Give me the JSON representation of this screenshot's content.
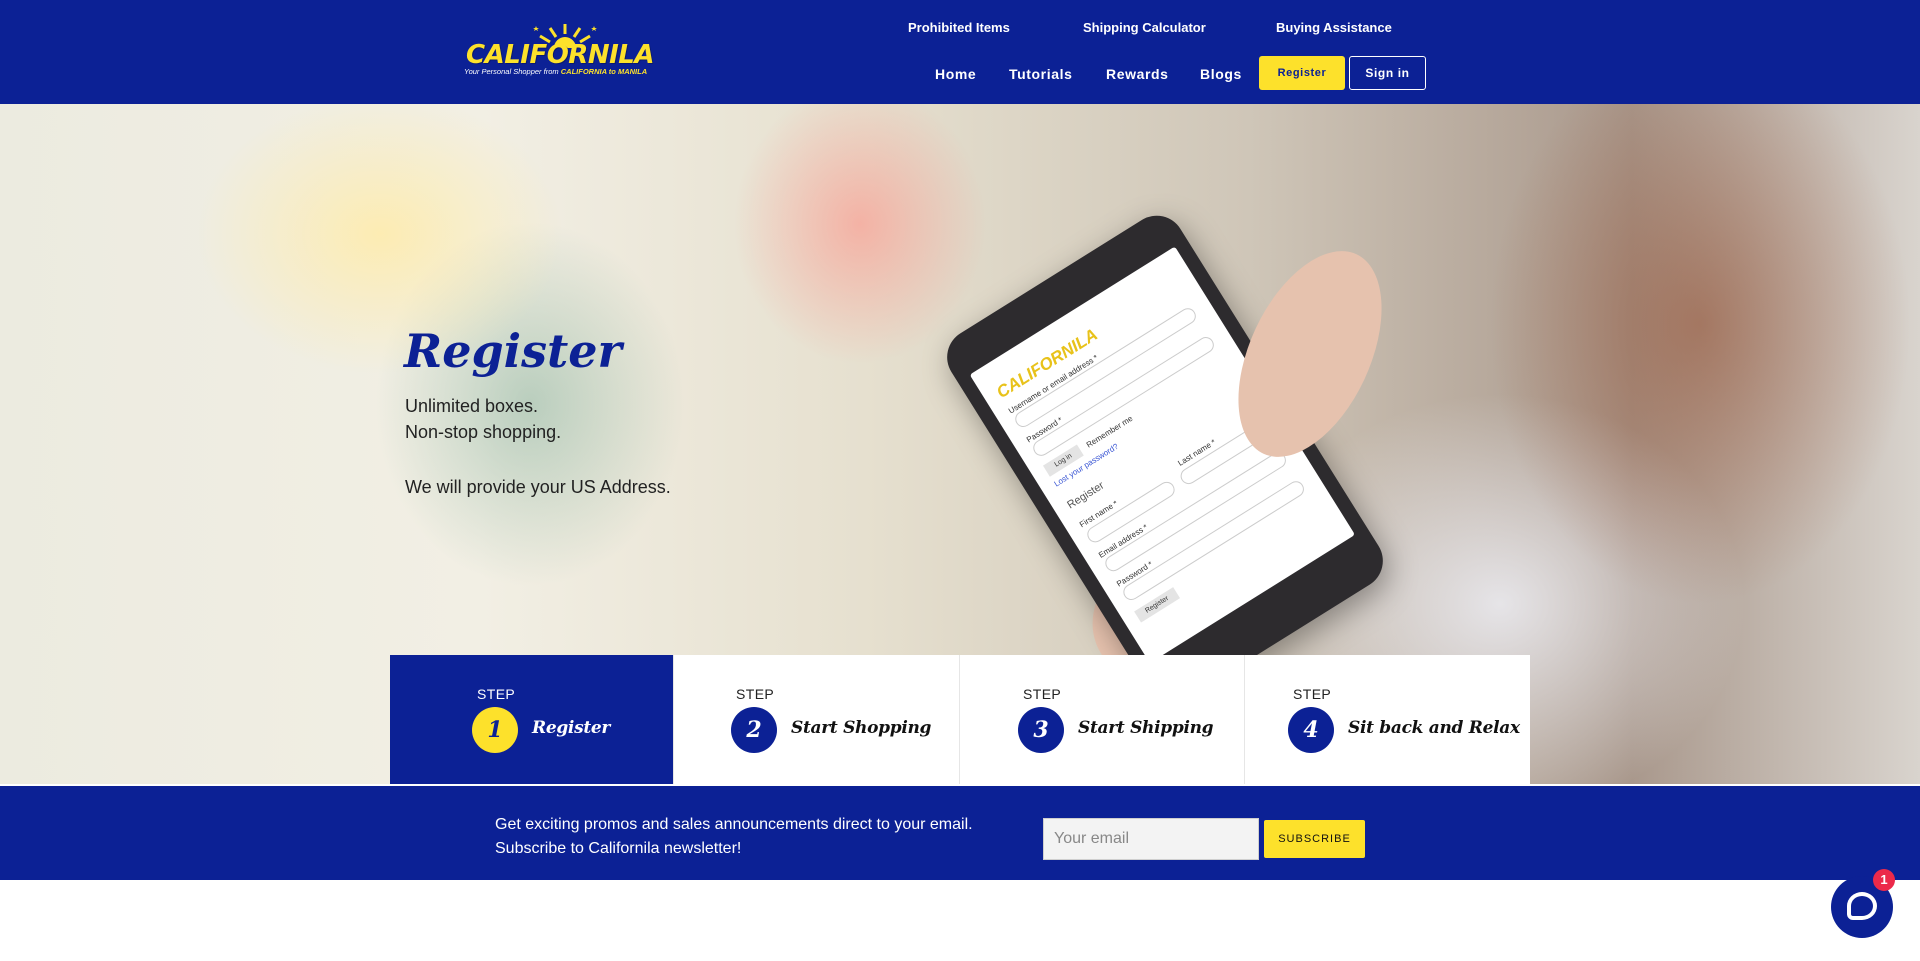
{
  "header": {
    "logo": {
      "wordmark": "CALIFORNILA",
      "tagline_prefix": "Your Personal Shopper from",
      "tagline_highlight": "CALIFORNIA to MANILA"
    },
    "top_links": [
      "Prohibited Items",
      "Shipping Calculator",
      "Buying Assistance"
    ],
    "nav": [
      "Home",
      "Tutorials",
      "Rewards",
      "Blogs"
    ],
    "register_label": "Register",
    "signin_label": "Sign in"
  },
  "hero": {
    "title": "Register",
    "lines": [
      "Unlimited boxes.",
      "Non-stop shopping.",
      "We will provide your US Address."
    ],
    "phone_screen": {
      "logo": "CALIFORNILA",
      "login_username_label": "Username or email address *",
      "login_password_label": "Password *",
      "login_button": "Log in",
      "remember_me": "Remember me",
      "lost_password": "Lost your password?",
      "register_heading": "Register",
      "first_name_label": "First name *",
      "last_name_label": "Last name *",
      "email_label": "Email address *",
      "password_label": "Password *",
      "register_button": "Register"
    }
  },
  "steps": [
    {
      "label": "STEP",
      "number": "1",
      "name": "Register",
      "active": true
    },
    {
      "label": "STEP",
      "number": "2",
      "name": "Start Shopping",
      "active": false
    },
    {
      "label": "STEP",
      "number": "3",
      "name": "Start Shipping",
      "active": false
    },
    {
      "label": "STEP",
      "number": "4",
      "name": "Sit back and Relax",
      "active": false
    }
  ],
  "newsletter": {
    "line1": "Get exciting promos and sales announcements direct to your email.",
    "line2": "Subscribe to Californila newsletter!",
    "email_placeholder": "Your email",
    "subscribe_label": "SUBSCRIBE"
  },
  "chat": {
    "icon": "chat-bubble-icon",
    "badge_count": "1"
  },
  "colors": {
    "brand_blue": "#0c2195",
    "brand_yellow": "#fde12b",
    "badge_red": "#ec2a4a"
  }
}
